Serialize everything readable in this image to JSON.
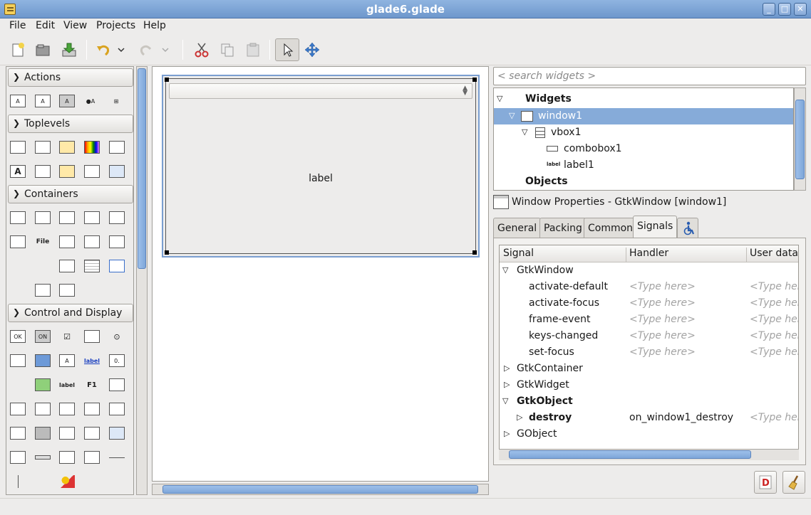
{
  "window": {
    "title": "glade6.glade"
  },
  "menu": [
    "File",
    "Edit",
    "View",
    "Projects",
    "Help"
  ],
  "toolbar": {
    "buttons": [
      "new-icon",
      "open-icon",
      "save-icon",
      "undo-icon",
      "redo-icon",
      "cut-icon",
      "copy-icon",
      "paste-icon",
      "select-pointer-icon",
      "drag-resize-icon"
    ]
  },
  "palette": {
    "groups": [
      {
        "label": "Actions",
        "items": [
          "A",
          "A",
          "A",
          "●A",
          "⊞"
        ]
      },
      {
        "label": "Toplevels",
        "items": [
          "",
          "",
          "",
          "",
          "",
          "A",
          "",
          "",
          "",
          ""
        ]
      },
      {
        "label": "Containers",
        "items": [
          "",
          "",
          "",
          "",
          "",
          "",
          "File",
          "",
          "",
          "",
          "",
          "",
          "",
          "",
          "",
          "",
          "",
          "",
          "",
          ""
        ]
      },
      {
        "label": "Control and Display",
        "items": [
          "OK",
          "ON",
          "☑",
          "",
          "⊙",
          "",
          "",
          "A",
          "label",
          "0.",
          "",
          "",
          "label",
          "F1",
          "",
          "",
          "",
          "",
          "",
          "",
          "",
          "",
          "",
          "",
          "",
          "",
          "",
          "",
          "",
          "",
          "",
          "",
          ""
        ]
      }
    ]
  },
  "design": {
    "label_text": "label"
  },
  "search": {
    "placeholder": "< search widgets >"
  },
  "tree": {
    "rows": [
      {
        "text": "Widgets",
        "icon": "",
        "bold": true
      },
      {
        "text": "window1",
        "icon": "window-icon",
        "bold": false
      },
      {
        "text": "vbox1",
        "icon": "vbox-icon",
        "bold": false
      },
      {
        "text": "combobox1",
        "icon": "combobox-icon",
        "bold": false
      },
      {
        "text": "label1",
        "icon": "label-icon",
        "bold": false
      },
      {
        "text": "Objects",
        "icon": "",
        "bold": true
      }
    ]
  },
  "properties": {
    "title": "Window Properties - GtkWindow [window1]",
    "tabs": [
      "General",
      "Packing",
      "Common",
      "Signals"
    ],
    "active_tab": "Signals",
    "accessibility_tab_icon": "accessibility-icon"
  },
  "signals": {
    "columns": [
      "Signal",
      "Handler",
      "User data"
    ],
    "rows": [
      {
        "signal": "GtkWindow",
        "handler": "",
        "userdata": "",
        "type": "group",
        "expanded": true
      },
      {
        "signal": "activate-default",
        "handler": "<Type here>",
        "userdata": "<Type here>",
        "type": "item"
      },
      {
        "signal": "activate-focus",
        "handler": "<Type here>",
        "userdata": "<Type here>",
        "type": "item"
      },
      {
        "signal": "frame-event",
        "handler": "<Type here>",
        "userdata": "<Type here>",
        "type": "item"
      },
      {
        "signal": "keys-changed",
        "handler": "<Type here>",
        "userdata": "<Type here>",
        "type": "item"
      },
      {
        "signal": "set-focus",
        "handler": "<Type here>",
        "userdata": "<Type here>",
        "type": "item"
      },
      {
        "signal": "GtkContainer",
        "handler": "",
        "userdata": "",
        "type": "group",
        "expanded": false
      },
      {
        "signal": "GtkWidget",
        "handler": "",
        "userdata": "",
        "type": "group",
        "expanded": false
      },
      {
        "signal": "GtkObject",
        "handler": "",
        "userdata": "",
        "type": "group-bold",
        "expanded": true
      },
      {
        "signal": "destroy",
        "handler": "on_window1_destroy",
        "userdata": "<Type here>",
        "type": "item-bold"
      },
      {
        "signal": "GObject",
        "handler": "",
        "userdata": "",
        "type": "group",
        "expanded": false
      }
    ]
  },
  "bottom_buttons": [
    "devhelp-icon",
    "clear-broom-icon"
  ]
}
